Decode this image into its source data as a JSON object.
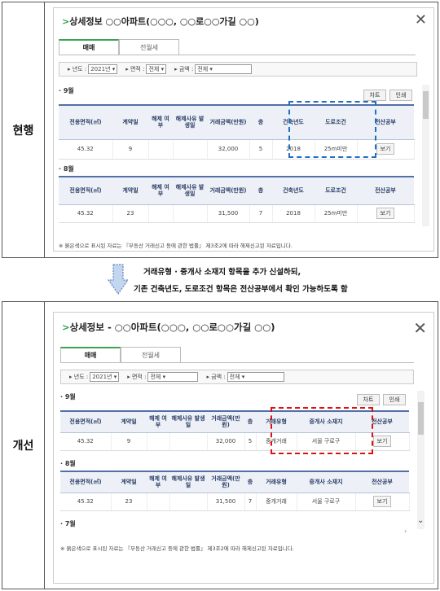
{
  "before": {
    "label": "현행",
    "title_arrow": ">",
    "title": "상세정보   ○○아파트(○○○, ○○로○○가길 ○○)",
    "close": "✕",
    "tabs": [
      "매매",
      "전월세"
    ],
    "filter": {
      "year_label": "년도 :",
      "year": "2021년",
      "area_label": "면적 :",
      "area": "전체",
      "price_label": "금액 :",
      "price": "전체"
    },
    "buttons": {
      "chart": "차트",
      "print": "인쇄"
    },
    "sections": [
      {
        "month": "· 9월",
        "headers": [
          "전용면적(㎡)",
          "계약일",
          "해제 여부",
          "해제사유 발생일",
          "거래금액(만원)",
          "층",
          "건축년도",
          "도로조건",
          "전산공부"
        ],
        "row": [
          "45.32",
          "9",
          "",
          "",
          "32,000",
          "5",
          "2018",
          "25m미만",
          "보기"
        ]
      },
      {
        "month": "· 8월",
        "headers": [
          "전용면적(㎡)",
          "계약일",
          "해제 여부",
          "해제사유 발생일",
          "거래금액(만원)",
          "층",
          "건축년도",
          "도로조건",
          "전산공부"
        ],
        "row": [
          "45.32",
          "23",
          "",
          "",
          "31,500",
          "7",
          "2018",
          "25m미만",
          "보기"
        ]
      }
    ],
    "note": "※ 붉은색으로 표시된 자료는 『부동산 거래신고 등에 관한 법률』 제3조2에 따라 해제신고된 자료입니다."
  },
  "middle": {
    "line1": "거래유형 · 중개사 소재지 항목을 추가 신설하되,",
    "line2": "기존 건축년도, 도로조건 항목은 전산공부에서 확인 가능하도록 함"
  },
  "after": {
    "label": "개선",
    "title_arrow": ">",
    "title": "상세정보 -   ○○아파트(○○○, ○○로○○가길 ○○)",
    "close": "✕",
    "tabs": [
      "매매",
      "전월세"
    ],
    "filter": {
      "year_label": "년도 :",
      "year": "2021년",
      "area_label": "면적 :",
      "area": "전체",
      "price_label": "금액 :",
      "price": "전체"
    },
    "buttons": {
      "chart": "차트",
      "print": "인쇄"
    },
    "sections": [
      {
        "month": "· 9월",
        "headers": [
          "전용면적(㎡)",
          "계약일",
          "해제 여부",
          "해제사유 발생일",
          "거래금액(만원)",
          "층",
          "거래유형",
          "중개사 소재지",
          "전산공부"
        ],
        "row": [
          "45.32",
          "9",
          "",
          "",
          "32,000",
          "5",
          "중개거래",
          "서울 구로구",
          "보기"
        ]
      },
      {
        "month": "· 8월",
        "headers": [
          "전용면적(㎡)",
          "계약일",
          "해제 여부",
          "해제사유 발생일",
          "거래금액(만원)",
          "층",
          "거래유형",
          "중개사 소재지",
          "전산공부"
        ],
        "row": [
          "45.32",
          "23",
          "",
          "",
          "31,500",
          "7",
          "중개거래",
          "서울 구로구",
          "보기"
        ]
      }
    ],
    "month7": "· 7월",
    "note": "※ 붉은색으로 표시된 자료는 『부동산 거래신고 등에 관한 법률』 제3조2에 따라 해제신고된 자료입니다."
  }
}
